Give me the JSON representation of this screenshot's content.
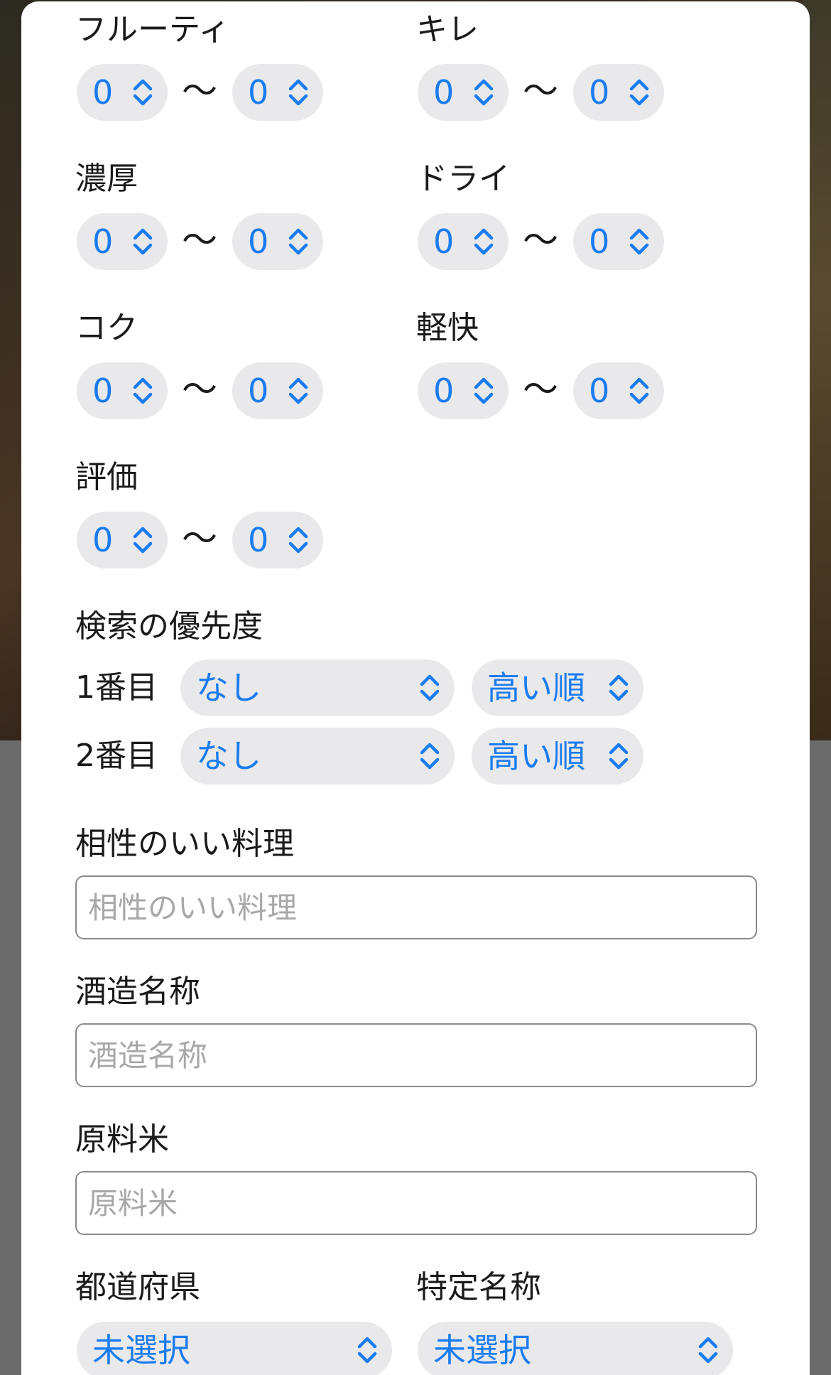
{
  "ranges": [
    {
      "label": "フルーティ",
      "min": "0",
      "max": "0"
    },
    {
      "label": "キレ",
      "min": "0",
      "max": "0"
    },
    {
      "label": "濃厚",
      "min": "0",
      "max": "0"
    },
    {
      "label": "ドライ",
      "min": "0",
      "max": "0"
    },
    {
      "label": "コク",
      "min": "0",
      "max": "0"
    },
    {
      "label": "軽快",
      "min": "0",
      "max": "0"
    },
    {
      "label": "評価",
      "min": "0",
      "max": "0"
    }
  ],
  "range_separator": "〜",
  "priority": {
    "title": "検索の優先度",
    "rows": [
      {
        "label": "1番目",
        "field": "なし",
        "order": "高い順"
      },
      {
        "label": "2番目",
        "field": "なし",
        "order": "高い順"
      }
    ]
  },
  "pairing": {
    "label": "相性のいい料理",
    "placeholder": "相性のいい料理",
    "value": ""
  },
  "brewery": {
    "label": "酒造名称",
    "placeholder": "酒造名称",
    "value": ""
  },
  "rice": {
    "label": "原料米",
    "placeholder": "原料米",
    "value": ""
  },
  "prefecture": {
    "label": "都道府県",
    "selected": "未選択"
  },
  "designation": {
    "label": "特定名称",
    "selected": "未選択"
  },
  "colors": {
    "accent": "#1a7cf0",
    "pill_bg": "#e9e9eb",
    "text": "#1a1a1a",
    "placeholder": "#a8a8a8"
  },
  "icons": {
    "stepper": "chevron-up-down-icon"
  }
}
